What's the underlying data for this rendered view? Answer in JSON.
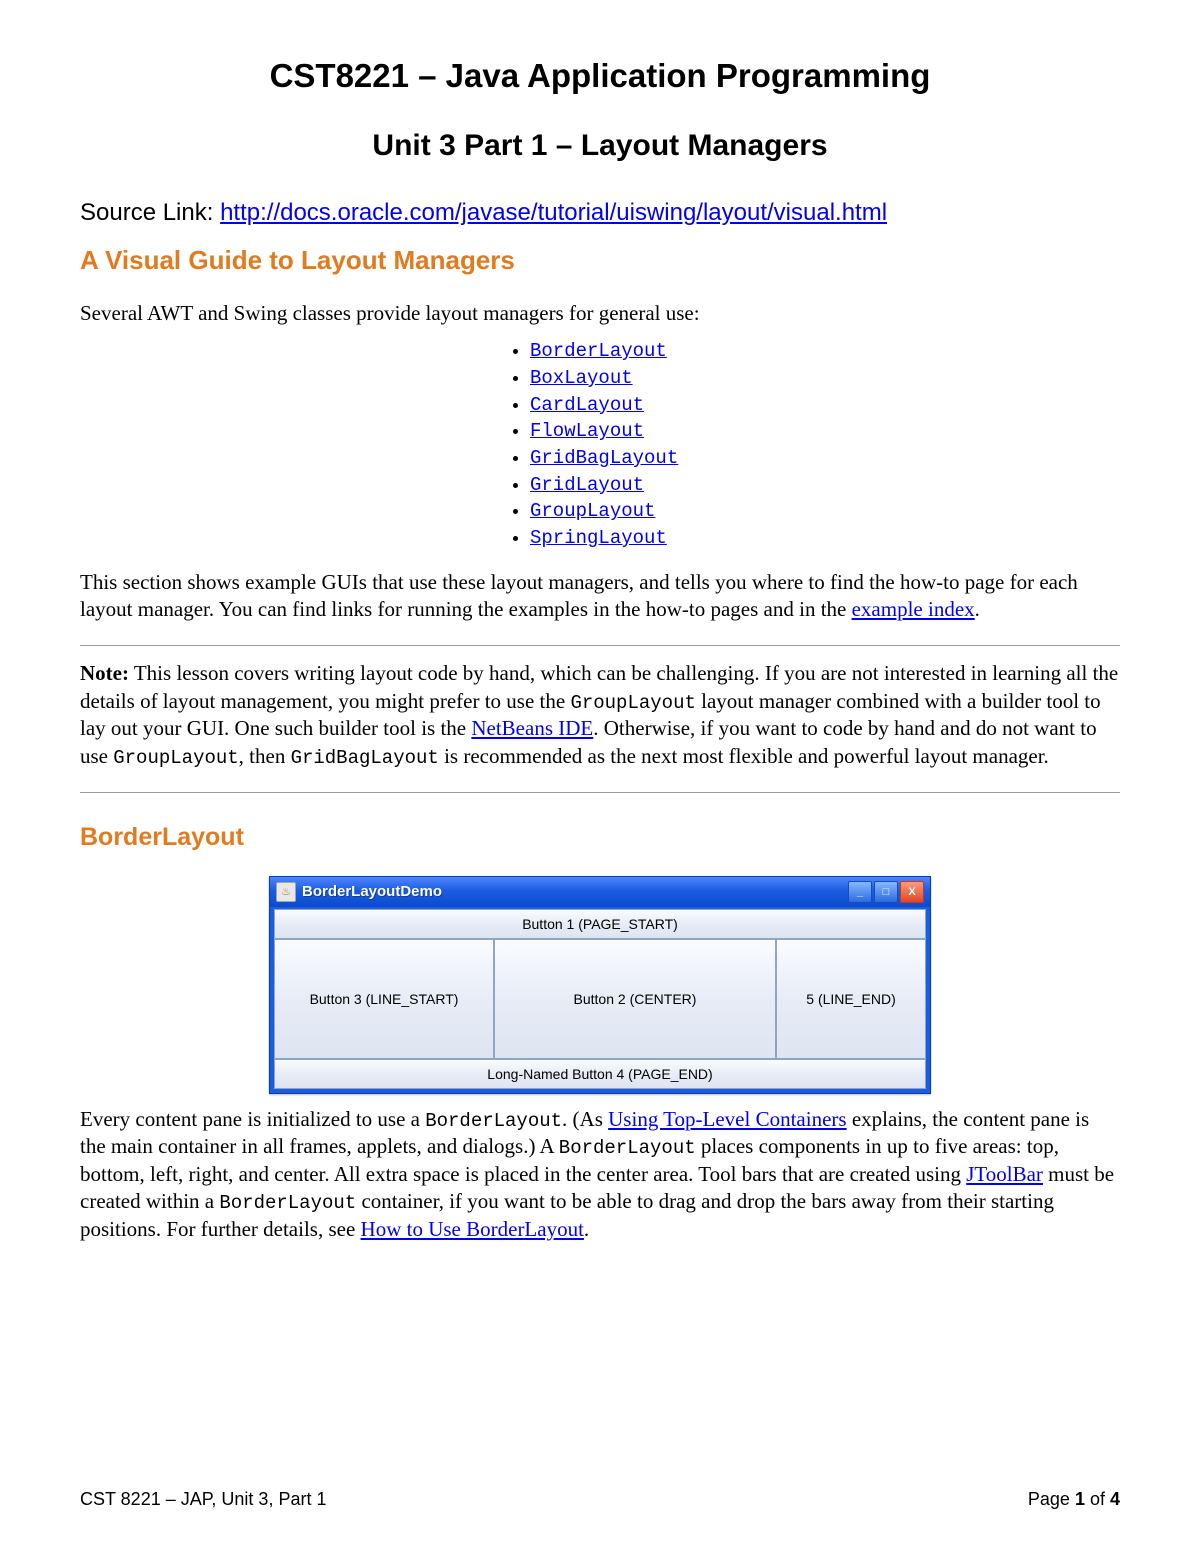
{
  "header": {
    "main_title": "CST8221 – Java Application Programming",
    "subtitle": "Unit 3 Part 1 – Layout Managers",
    "source_label": "Source Link:   ",
    "source_url": "http://docs.oracle.com/javase/tutorial/uiswing/layout/visual.html"
  },
  "visual_guide": {
    "heading": "A Visual Guide to Layout Managers",
    "intro": "Several AWT and Swing classes provide layout managers for general use:",
    "layouts": [
      "BorderLayout",
      "BoxLayout",
      "CardLayout",
      "FlowLayout",
      "GridBagLayout",
      "GridLayout",
      "GroupLayout",
      "SpringLayout"
    ],
    "para2_pre": "This section shows example GUIs that use these layout managers, and tells you where to find the how-to page for each layout manager. You can find links for running the examples in the how-to pages and in the ",
    "example_index_link": "example index",
    "para2_post": "."
  },
  "note": {
    "label": "Note:",
    "p1a": " This lesson covers writing layout code by hand, which can be challenging. If you are not interested in learning all the details of layout management, you might prefer to use the ",
    "code1": "GroupLayout",
    "p1b": " layout manager combined with a builder tool to lay out your GUI. One such builder tool is the ",
    "netbeans_link": "NetBeans IDE",
    "p1c": ". Otherwise, if you want to code by hand and do not want to use ",
    "code2": "GroupLayout",
    "p1d": ", then ",
    "code3": "GridBagLayout",
    "p1e": " is recommended as the next most flexible and powerful layout manager."
  },
  "borderlayout": {
    "heading": "BorderLayout",
    "window_title": "BorderLayoutDemo",
    "java_glyph": "♨",
    "buttons": {
      "page_start": "Button 1 (PAGE_START)",
      "line_start": "Button 3 (LINE_START)",
      "center": "Button 2 (CENTER)",
      "line_end": "5 (LINE_END)",
      "page_end": "Long-Named Button 4 (PAGE_END)"
    },
    "desc_a": "Every content pane is initialized to use a ",
    "code_bl1": "BorderLayout",
    "desc_b": ". (As ",
    "link_top": "Using Top-Level Containers",
    "desc_c": " explains, the content pane is the main container in all frames, applets, and dialogs.) A ",
    "code_bl2": "BorderLayout",
    "desc_d": " places components in up to five areas: top, bottom, left, right, and center. All extra space is placed in the center area. Tool bars that are created using ",
    "link_jtoolbar": "JToolBar",
    "desc_e": " must be created within a ",
    "code_bl3": "BorderLayout",
    "desc_f": " container, if you want to be able to drag and drop the bars away from their starting positions. For further details, see ",
    "link_howto": "How to Use BorderLayout",
    "desc_g": "."
  },
  "footer": {
    "left": "CST 8221 – JAP, Unit 3, Part 1",
    "right_pre": "Page ",
    "page_now": "1",
    "right_mid": " of ",
    "page_total": "4"
  },
  "win_controls": {
    "min": "_",
    "max": "□",
    "close": "X"
  }
}
